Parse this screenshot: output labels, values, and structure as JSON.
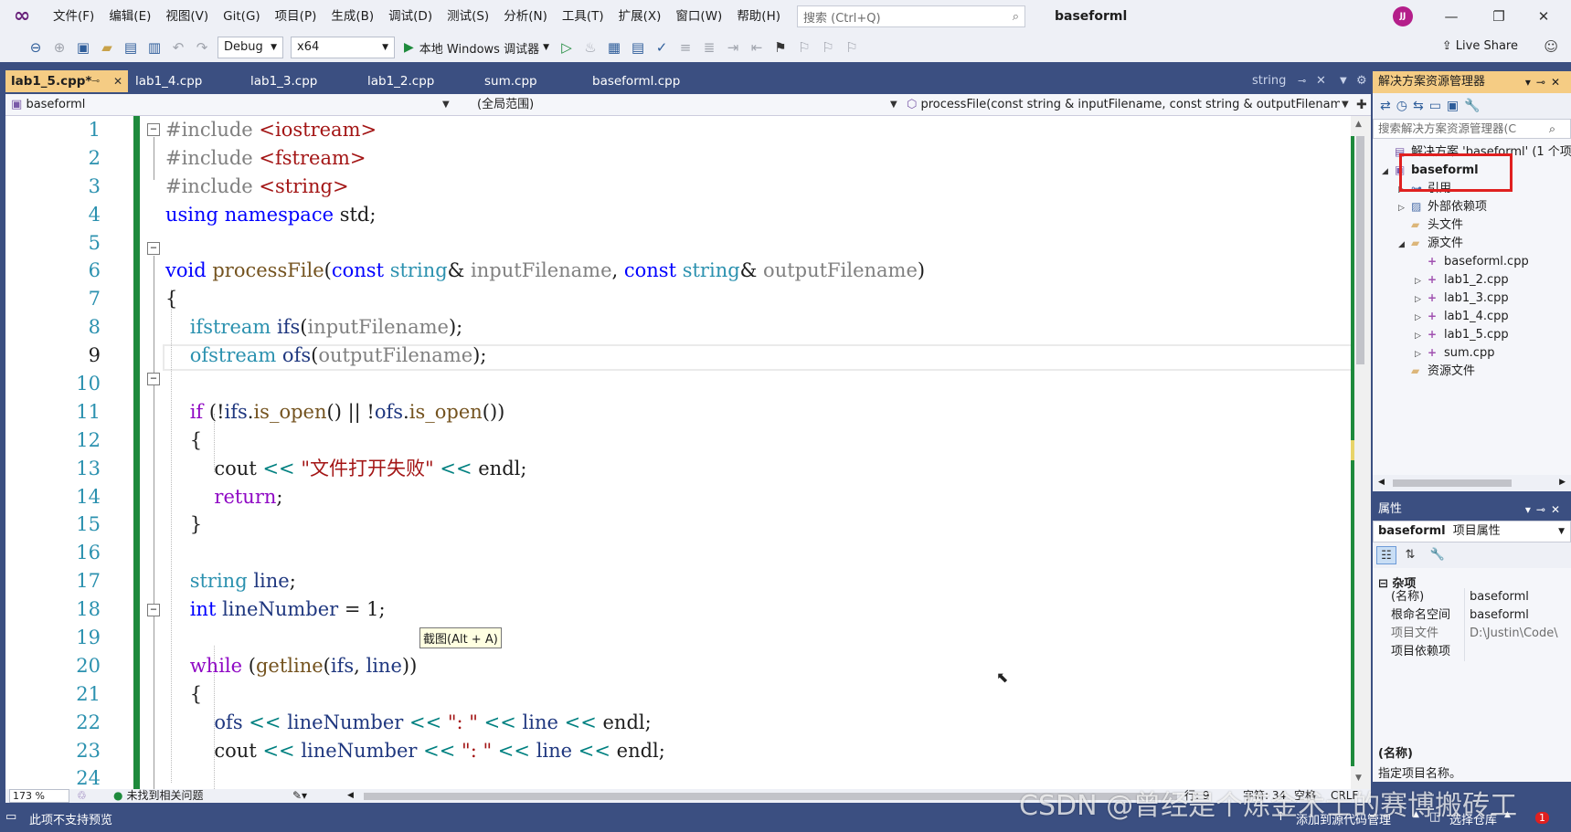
{
  "menubar": {
    "items": [
      "文件(F)",
      "编辑(E)",
      "视图(V)",
      "Git(G)",
      "项目(P)",
      "生成(B)",
      "调试(D)",
      "测试(S)",
      "分析(N)",
      "工具(T)",
      "扩展(X)",
      "窗口(W)",
      "帮助(H)"
    ],
    "search_placeholder": "搜索 (Ctrl+Q)",
    "solution_title": "baseforml",
    "avatar_initials": "JJ"
  },
  "toolbar": {
    "config": "Debug",
    "platform": "x64",
    "run_label": "本地 Windows 调试器",
    "live_share": "Live Share"
  },
  "tabs": [
    {
      "label": "lab1_5.cpp*",
      "active": true
    },
    {
      "label": "lab1_4.cpp"
    },
    {
      "label": "lab1_3.cpp"
    },
    {
      "label": "lab1_2.cpp"
    },
    {
      "label": "sum.cpp"
    },
    {
      "label": "baseforml.cpp"
    }
  ],
  "tab_right": {
    "label": "string"
  },
  "navbar": {
    "project": "baseforml",
    "scope": "(全局范围)",
    "member": "processFile(const string & inputFilename, const string & outputFilename)"
  },
  "editor": {
    "current_line": 9,
    "line_numbers": [
      "1",
      "2",
      "3",
      "4",
      "5",
      "6",
      "7",
      "8",
      "9",
      "10",
      "11",
      "12",
      "13",
      "14",
      "15",
      "16",
      "17",
      "18",
      "19",
      "20",
      "21",
      "22",
      "23",
      "24"
    ],
    "tooltip": "截图(Alt + A)"
  },
  "edstatus": {
    "zoom": "173 %",
    "issues": "未找到相关问题",
    "line": "行: 9",
    "col": "字符: 34",
    "spaces": "空格",
    "eol": "CRLF"
  },
  "statusbar": {
    "left": "此项不支持预览",
    "add_source": "添加到源代码管理",
    "select_repo": "选择仓库",
    "notifications": "1"
  },
  "watermark": "CSDN @曾经是个炼金术士的赛博搬砖工",
  "solution_explorer": {
    "title": "解决方案资源管理器",
    "search_placeholder": "搜索解决方案资源管理器(C",
    "solution_node": "解决方案 'baseforml' (1 个项",
    "project_node": "baseforml",
    "nodes": [
      "引用",
      "外部依赖项",
      "头文件",
      "源文件"
    ],
    "source_files": [
      "baseforml.cpp",
      "lab1_2.cpp",
      "lab1_3.cpp",
      "lab1_4.cpp",
      "lab1_5.cpp",
      "sum.cpp"
    ],
    "resource_node": "资源文件"
  },
  "properties": {
    "title": "属性",
    "selector_name": "baseforml",
    "selector_type": "项目属性",
    "category": "杂项",
    "rows": [
      {
        "key": "(名称)",
        "value": "baseforml"
      },
      {
        "key": "根命名空间",
        "value": "baseforml"
      },
      {
        "key": "项目文件",
        "value": "D:\\Justin\\Code\\"
      },
      {
        "key": "项目依赖项",
        "value": ""
      }
    ],
    "desc_title": "(名称)",
    "desc_text": "指定项目名称。"
  },
  "colors": {
    "frame": "#3b4f81",
    "active_tab": "#f5cc84",
    "modified_bar": "#1e8a3c",
    "highlight_box": "#e02020"
  }
}
